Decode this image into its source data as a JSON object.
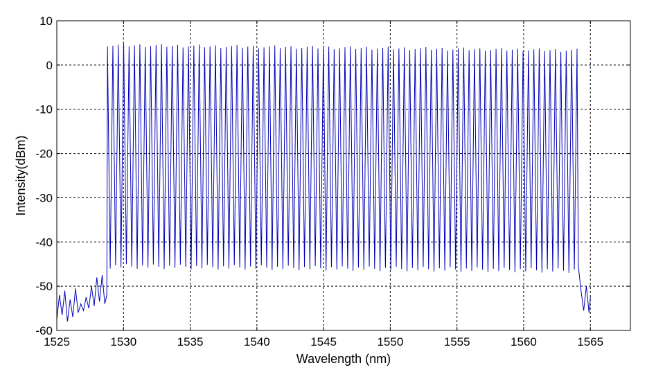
{
  "chart_data": {
    "type": "line",
    "title": "",
    "xlabel": "Wavelength (nm)",
    "ylabel": "Intensity(dBm)",
    "xlim": [
      1525,
      1568
    ],
    "ylim": [
      -60,
      10
    ],
    "x_ticks": [
      1525,
      1530,
      1535,
      1540,
      1545,
      1550,
      1555,
      1560,
      1565
    ],
    "y_ticks": [
      10,
      0,
      -10,
      -20,
      -30,
      -40,
      -50,
      -60
    ],
    "grid": true,
    "line_color": "#0000b8",
    "series": [
      {
        "peaks": {
          "start_nm": 1528.8,
          "end_nm": 1564.0,
          "count": 88,
          "peak_dBm_start": 4.5,
          "peak_dBm_end": 3.3,
          "trough_dBm_start": -45.5,
          "trough_dBm_end": -46.5
        },
        "noise_floor": [
          [
            1525.0,
            -57.5
          ],
          [
            1525.2,
            -52.0
          ],
          [
            1525.4,
            -56.5
          ],
          [
            1525.6,
            -51.0
          ],
          [
            1525.8,
            -58.0
          ],
          [
            1526.0,
            -53.0
          ],
          [
            1526.2,
            -57.0
          ],
          [
            1526.4,
            -50.5
          ],
          [
            1526.6,
            -56.0
          ],
          [
            1526.8,
            -54.0
          ],
          [
            1527.0,
            -55.5
          ],
          [
            1527.2,
            -52.5
          ],
          [
            1527.4,
            -55.0
          ],
          [
            1527.6,
            -50.0
          ],
          [
            1527.8,
            -54.5
          ],
          [
            1528.0,
            -48.0
          ],
          [
            1528.2,
            -53.5
          ],
          [
            1528.4,
            -47.5
          ],
          [
            1528.6,
            -54.0
          ],
          [
            1528.75,
            -52.0
          ],
          [
            1564.1,
            -45.5
          ],
          [
            1564.3,
            -51.0
          ],
          [
            1564.5,
            -55.5
          ],
          [
            1564.7,
            -50.0
          ],
          [
            1564.9,
            -56.0
          ],
          [
            1565.0,
            -52.5
          ]
        ]
      }
    ]
  }
}
